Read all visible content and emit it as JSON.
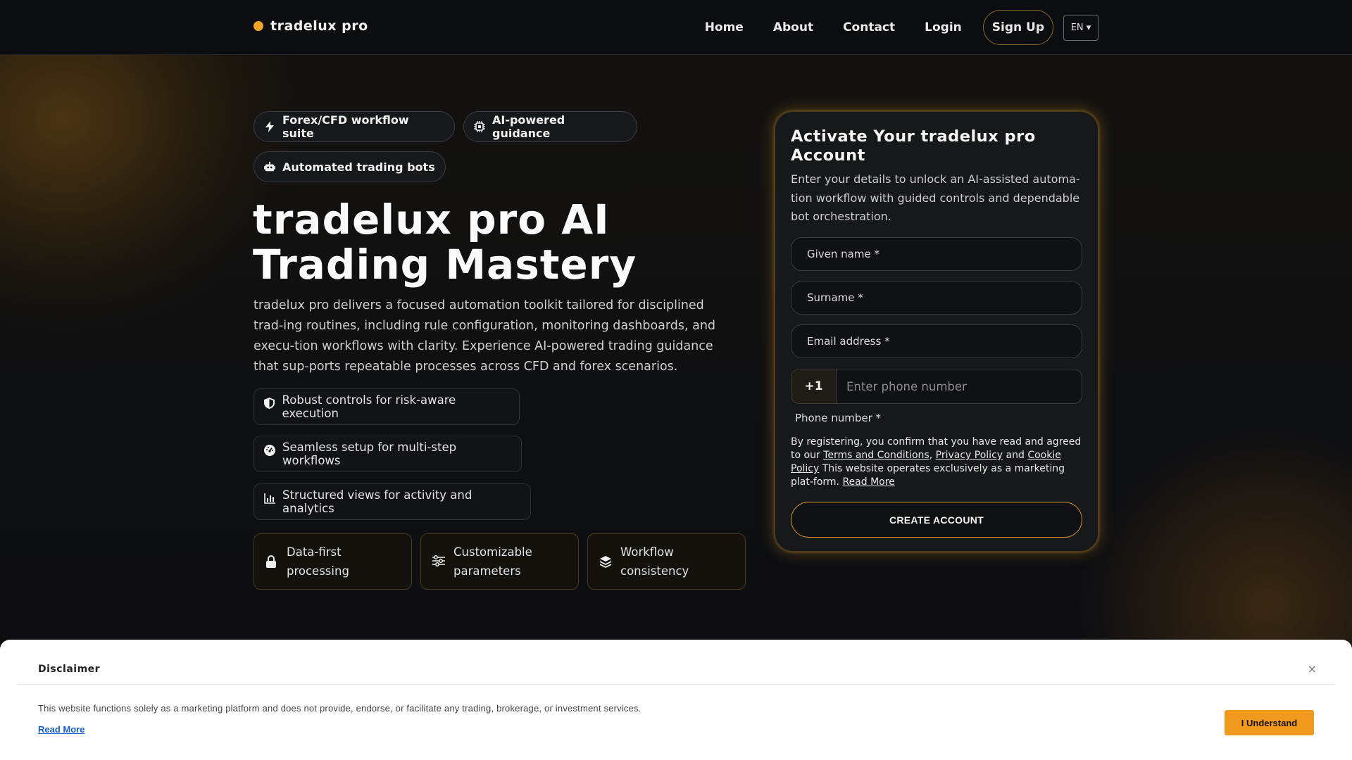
{
  "brand": {
    "name": "tradelux pro",
    "accent": "#f2a32a"
  },
  "nav": {
    "items": [
      "Home",
      "About",
      "Contact",
      "Login"
    ],
    "signup": "Sign Up",
    "lang": "EN ▾"
  },
  "hero": {
    "chips": [
      {
        "label": "Forex/CFD workflow suite",
        "icon": "bolt-icon"
      },
      {
        "label": "AI-powered guidance",
        "icon": "chip-icon"
      },
      {
        "label": "Automated trading bots",
        "icon": "robot-icon"
      }
    ],
    "title": "tradelux pro AI Trading Mastery",
    "title_line1": "tradelux pro AI",
    "title_line2": "Trading Mastery",
    "lead": "tradelux pro delivers a focused automation toolkit tailored for disciplined trad-ing routines, including rule configuration, monitoring dashboards, and execu-tion workflows with clarity. Experience AI-powered trading guidance that sup-ports repeatable processes across CFD and forex scenarios.",
    "features": [
      {
        "label": "Robust controls for risk-aware execution",
        "icon": "shield-icon"
      },
      {
        "label": "Seamless setup for multi-step workflows",
        "icon": "gauge-icon"
      },
      {
        "label": "Structured views for activity and analytics",
        "icon": "bar-chart-icon"
      }
    ],
    "cards": [
      {
        "label": "Data-first processing",
        "icon": "lock-icon"
      },
      {
        "label": "Customizable parameters",
        "icon": "sliders-icon"
      },
      {
        "label": "Workflow consistency",
        "icon": "layers-icon"
      }
    ]
  },
  "form": {
    "title": "Activate Your tradelux pro Account",
    "subtitle": "Enter your details to unlock an AI-assisted automa-tion workflow with guided controls and dependable bot orchestration.",
    "given_name": "Given name *",
    "surname": "Surname *",
    "email": "Email address *",
    "country_code": "+1",
    "phone_placeholder": "Enter phone number",
    "phone_label": "Phone number *",
    "legal": {
      "prefix": "By registering, you confirm that you have read and agreed to our",
      "terms": "Terms and Conditions",
      "privacy": "Privacy Policy",
      "and": "and",
      "cookie": "Cookie Policy",
      "notice": "This website operates exclusively as a marketing plat-form.",
      "read_more": "Read More"
    },
    "submit": "CREATE ACCOUNT"
  },
  "disclaimer": {
    "title": "Disclaimer",
    "close": "×",
    "text": "This website functions solely as a marketing platform and does not provide, endorse, or facilitate any trading, brokerage, or investment services.",
    "read_more": "Read More",
    "accept": "I Understand"
  }
}
